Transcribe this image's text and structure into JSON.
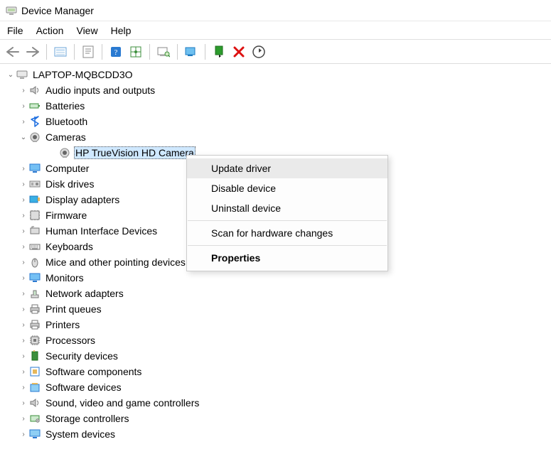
{
  "window": {
    "title": "Device Manager"
  },
  "menubar": {
    "file": "File",
    "action": "Action",
    "view": "View",
    "help": "Help"
  },
  "toolbar_icons": {
    "back": "back-arrow",
    "forward": "forward-arrow",
    "show_hidden": "show-hidden",
    "properties_sheet": "properties-sheet",
    "help": "help",
    "action_list": "action-list",
    "scan_hw": "scan-hardware",
    "monitor": "update-driver",
    "enable": "enable-device",
    "disable": "disable-device",
    "uninstall": "uninstall-device"
  },
  "root": {
    "name": "LAPTOP-MQBCDD3O"
  },
  "categories": [
    {
      "label": "Audio inputs and outputs",
      "icon": "speaker-icon",
      "expanded": false
    },
    {
      "label": "Batteries",
      "icon": "battery-icon",
      "expanded": false
    },
    {
      "label": "Bluetooth",
      "icon": "bluetooth-icon",
      "expanded": false
    },
    {
      "label": "Cameras",
      "icon": "camera-icon",
      "expanded": true,
      "children": [
        {
          "label": "HP TrueVision HD Camera",
          "icon": "camera-icon",
          "selected": true
        }
      ]
    },
    {
      "label": "Computer",
      "icon": "monitor-icon",
      "expanded": false
    },
    {
      "label": "Disk drives",
      "icon": "disk-icon",
      "expanded": false
    },
    {
      "label": "Display adapters",
      "icon": "display-adapter-icon",
      "expanded": false
    },
    {
      "label": "Firmware",
      "icon": "firmware-icon",
      "expanded": false
    },
    {
      "label": "Human Interface Devices",
      "icon": "hid-icon",
      "expanded": false
    },
    {
      "label": "Keyboards",
      "icon": "keyboard-icon",
      "expanded": false
    },
    {
      "label": "Mice and other pointing devices",
      "icon": "mouse-icon",
      "expanded": false
    },
    {
      "label": "Monitors",
      "icon": "monitor-icon",
      "expanded": false
    },
    {
      "label": "Network adapters",
      "icon": "network-icon",
      "expanded": false
    },
    {
      "label": "Print queues",
      "icon": "printer-icon",
      "expanded": false
    },
    {
      "label": "Printers",
      "icon": "printer-icon",
      "expanded": false
    },
    {
      "label": "Processors",
      "icon": "cpu-icon",
      "expanded": false
    },
    {
      "label": "Security devices",
      "icon": "security-icon",
      "expanded": false
    },
    {
      "label": "Software components",
      "icon": "software-component-icon",
      "expanded": false
    },
    {
      "label": "Software devices",
      "icon": "software-device-icon",
      "expanded": false
    },
    {
      "label": "Sound, video and game controllers",
      "icon": "speaker-icon",
      "expanded": false
    },
    {
      "label": "Storage controllers",
      "icon": "storage-controller-icon",
      "expanded": false
    },
    {
      "label": "System devices",
      "icon": "system-device-icon",
      "expanded": false
    }
  ],
  "context_menu": {
    "update_driver": "Update driver",
    "disable_device": "Disable device",
    "uninstall_device": "Uninstall device",
    "scan_changes": "Scan for hardware changes",
    "properties": "Properties",
    "highlighted": "update_driver",
    "default": "properties"
  }
}
